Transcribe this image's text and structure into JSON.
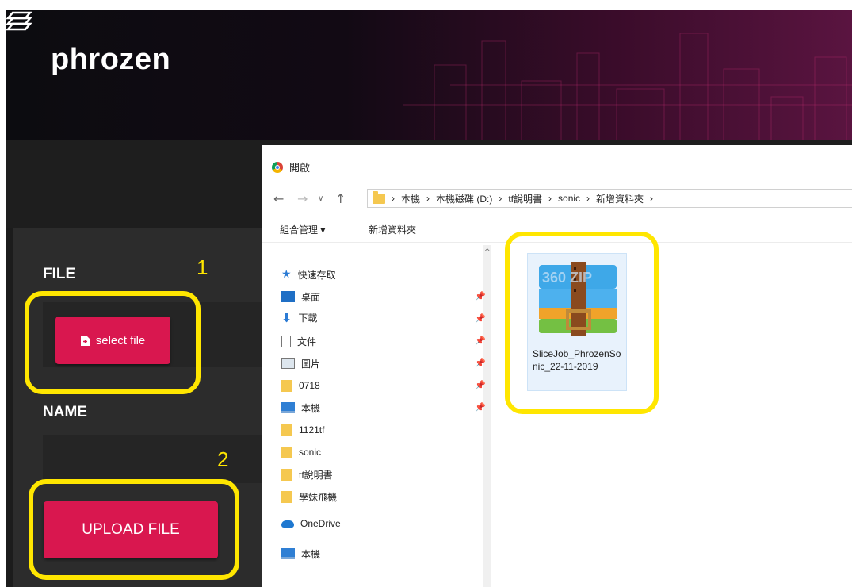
{
  "app": {
    "brand": "phrozen",
    "labels": {
      "file": "FILE",
      "name": "NAME"
    },
    "buttons": {
      "select_file": "select file",
      "upload_file": "UPLOAD FILE"
    }
  },
  "annotations": {
    "step1": "1",
    "step2": "2",
    "highlight_color": "#ffe600"
  },
  "colors": {
    "accent": "#d9174f",
    "panel": "#2c2c2c",
    "header_glow": "#5a1440"
  },
  "dialog": {
    "title": "開啟",
    "address": [
      "本機",
      "本機磁碟 (D:)",
      "tf說明書",
      "sonic",
      "新增資料夾"
    ],
    "toolbar": {
      "organize": "組合管理 ▾",
      "new_folder": "新增資料夾"
    },
    "nav_items": [
      {
        "label": "快速存取",
        "icon": "star-icon",
        "pinned": false
      },
      {
        "label": "桌面",
        "icon": "desktop-icon",
        "pinned": true
      },
      {
        "label": "下載",
        "icon": "download-icon",
        "pinned": true
      },
      {
        "label": "文件",
        "icon": "document-icon",
        "pinned": true
      },
      {
        "label": "圖片",
        "icon": "picture-icon",
        "pinned": true
      },
      {
        "label": "0718",
        "icon": "folder-icon",
        "pinned": true
      },
      {
        "label": "本機",
        "icon": "computer-icon",
        "pinned": true
      },
      {
        "label": "1121tf",
        "icon": "folder-icon",
        "pinned": false
      },
      {
        "label": "sonic",
        "icon": "folder-icon",
        "pinned": false
      },
      {
        "label": "tf說明書",
        "icon": "folder-icon",
        "pinned": false
      },
      {
        "label": "學妹飛機",
        "icon": "folder-icon",
        "pinned": false
      },
      {
        "label": "OneDrive",
        "icon": "onedrive-icon",
        "pinned": false
      },
      {
        "label": "本機",
        "icon": "computer-icon",
        "pinned": false
      }
    ],
    "file": {
      "name": "SliceJob_PhrozenSonic_22-11-2019",
      "icon_text": "360 ZIP"
    }
  }
}
